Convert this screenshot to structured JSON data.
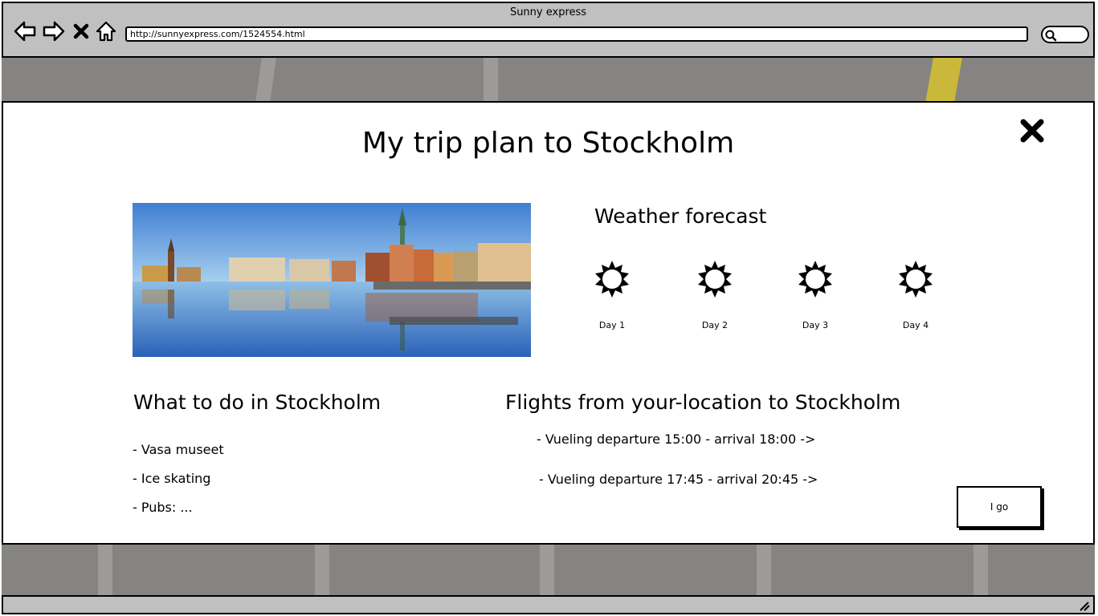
{
  "window": {
    "title": "Sunny express"
  },
  "address_bar": {
    "url": "http://sunnyexpress.com/1524554.html"
  },
  "toolbar": {
    "icons": [
      "back-arrow-icon",
      "forward-arrow-icon",
      "close-x-icon",
      "home-icon",
      "search-icon"
    ]
  },
  "modal": {
    "title": "My trip plan to Stockholm",
    "close_icon": "close-x-icon",
    "photo": {
      "subject": "stockholm-panorama-photo"
    },
    "weather": {
      "heading": "Weather forecast",
      "days": [
        {
          "label": "Day 1",
          "icon": "sun-icon"
        },
        {
          "label": "Day 2",
          "icon": "sun-icon"
        },
        {
          "label": "Day 3",
          "icon": "sun-icon"
        },
        {
          "label": "Day 4",
          "icon": "sun-icon"
        }
      ]
    },
    "todo": {
      "heading": "What to do in Stockholm",
      "items": [
        "- Vasa museet",
        "- Ice skating",
        "- Pubs: ..."
      ]
    },
    "flights": {
      "heading": "Flights from your-location to Stockholm",
      "items": [
        "- Vueling departure 15:00 - arrival 18:00 ->",
        "- Vueling departure 17:45 - arrival 20:45 ->"
      ]
    },
    "go_button_label": "I go"
  },
  "colors": {
    "chrome": "#c0c0c0",
    "backdrop": "#858480",
    "modal_bg": "#ffffff",
    "ink": "#000000"
  }
}
